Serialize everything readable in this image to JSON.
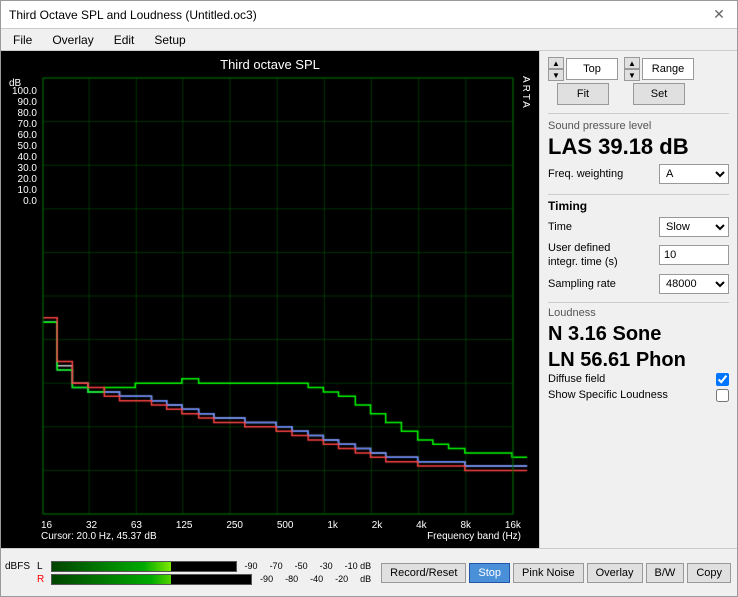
{
  "window": {
    "title": "Third Octave SPL and Loudness (Untitled.oc3)"
  },
  "menu": {
    "items": [
      "File",
      "Overlay",
      "Edit",
      "Setup"
    ]
  },
  "chart": {
    "title": "Third octave SPL",
    "y_axis_label": "dB",
    "y_axis_values": [
      "100.0",
      "90.0",
      "80.0",
      "70.0",
      "60.0",
      "50.0",
      "40.0",
      "30.0",
      "20.0",
      "10.0",
      "0.0"
    ],
    "x_axis_values": [
      "16",
      "32",
      "63",
      "125",
      "250",
      "500",
      "1k",
      "2k",
      "4k",
      "8k",
      "16k"
    ],
    "arta_label": "A\nR\nT\nA",
    "cursor_info": "Cursor:  20.0 Hz, 45.37 dB",
    "x_axis_title": "Frequency band (Hz)"
  },
  "controls": {
    "top_label": "Top",
    "top_value": "Fit",
    "range_label": "Range",
    "range_value": "Set"
  },
  "spl": {
    "section_label": "Sound pressure level",
    "value": "LAS 39.18 dB",
    "freq_weighting_label": "Freq. weighting",
    "freq_weighting_value": "A"
  },
  "timing": {
    "section_label": "Timing",
    "time_label": "Time",
    "time_value": "Slow",
    "user_defined_label": "User defined integr. time (s)",
    "user_defined_value": "10",
    "sampling_rate_label": "Sampling rate",
    "sampling_rate_value": "48000"
  },
  "loudness": {
    "section_label": "Loudness",
    "n_value": "N 3.16 Sone",
    "ln_value": "LN 56.61 Phon",
    "diffuse_field_label": "Diffuse field",
    "diffuse_field_checked": true,
    "show_specific_label": "Show Specific Loudness",
    "show_specific_checked": false
  },
  "bottom_buttons": [
    {
      "label": "Record/Reset",
      "name": "record-reset-button",
      "active": false
    },
    {
      "label": "Stop",
      "name": "stop-button",
      "active": true
    },
    {
      "label": "Pink Noise",
      "name": "pink-noise-button",
      "active": false
    },
    {
      "label": "Overlay",
      "name": "overlay-button",
      "active": false
    },
    {
      "label": "B/W",
      "name": "bw-button",
      "active": false
    },
    {
      "label": "Copy",
      "name": "copy-button",
      "active": false
    }
  ],
  "meter": {
    "channel_r_label": "R",
    "channel_l_label": "L",
    "ticks_top": [
      "-90",
      "",
      "-70",
      "",
      "-50",
      "",
      "-30",
      "",
      "-10 dB"
    ],
    "ticks_bottom": [
      "-90",
      "",
      "-80",
      "",
      "-40",
      "",
      "-20",
      "",
      "dB"
    ]
  }
}
